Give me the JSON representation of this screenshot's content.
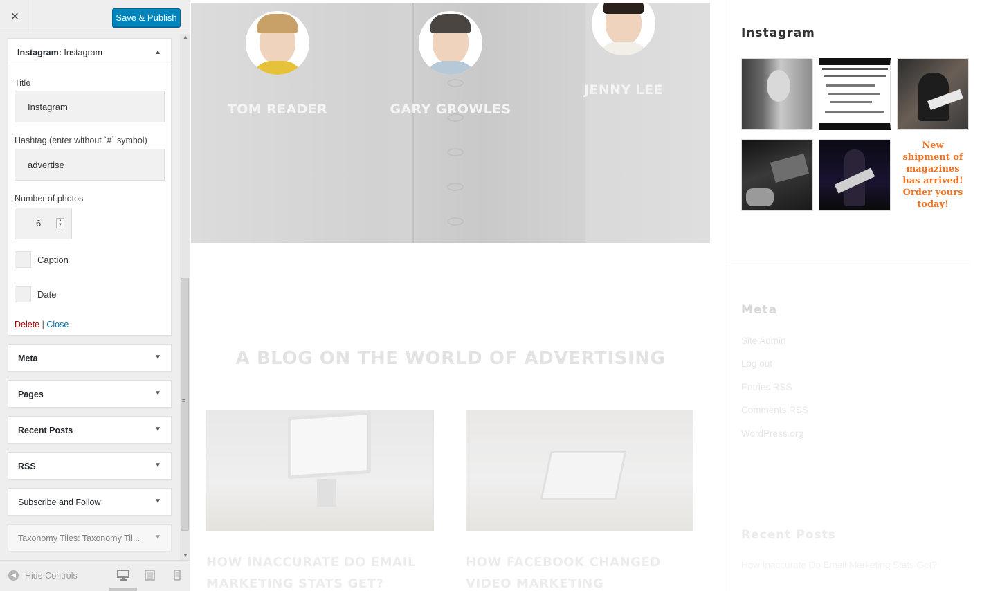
{
  "customizer": {
    "close_glyph": "×",
    "publish_label": "Save & Publish",
    "open_widget": {
      "type": "Instagram:",
      "instance": "Instagram",
      "fields": {
        "title_label": "Title",
        "title_value": "Instagram",
        "hashtag_label": "Hashtag (enter without `#` symbol)",
        "hashtag_value": "advertise",
        "number_label": "Number of photos",
        "number_value": "6",
        "caption_label": "Caption",
        "date_label": "Date"
      },
      "delete_label": "Delete",
      "separator": "|",
      "close_label": "Close"
    },
    "widgets": [
      {
        "label": "Meta"
      },
      {
        "label": "Pages"
      },
      {
        "label": "Recent Posts"
      },
      {
        "label": "RSS"
      },
      {
        "label": "Subscribe and Follow"
      },
      {
        "label": "Taxonomy Tiles:",
        "sub": "Taxonomy Til..."
      }
    ],
    "hide_controls_label": "Hide Controls"
  },
  "preview": {
    "team": [
      {
        "name": "TOM READER"
      },
      {
        "name": "GARY GROWLES"
      },
      {
        "name": "JENNY LEE"
      }
    ],
    "blog_heading": "A BLOG ON THE WORLD OF ADVERTISING",
    "posts": [
      {
        "title": "HOW INACCURATE DO EMAIL MARKETING STATS GET?"
      },
      {
        "title": "HOW FACEBOOK CHANGED VIDEO MARKETING"
      }
    ],
    "sidebar": {
      "instagram_title": "Instagram",
      "promo_text": "New shipment of magazines has arrived! Order yours today!",
      "meta_title": "Meta",
      "meta_links": [
        "Site Admin",
        "Log out",
        "Entries RSS",
        "Comments RSS",
        "WordPress.org"
      ],
      "recent_posts_title": "Recent Posts",
      "recent_post_link": "How Inaccurate Do Email Marketing Stats Get?"
    }
  },
  "colors": {
    "publish_bg": "#0085ba",
    "delete_link": "#aa0000",
    "close_link": "#0073aa",
    "promo_text": "#f27321"
  }
}
